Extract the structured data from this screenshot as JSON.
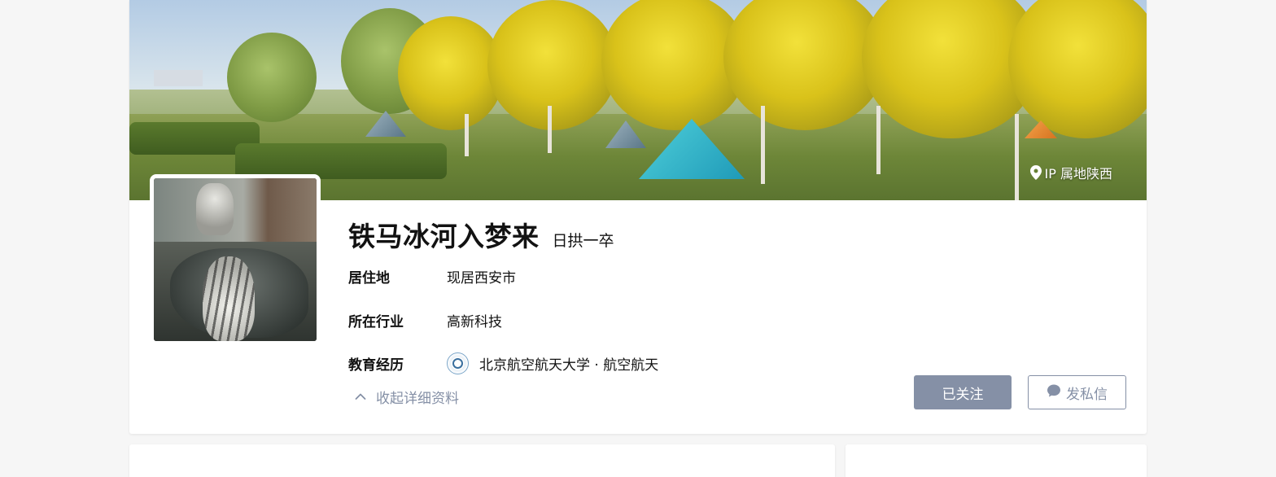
{
  "profile": {
    "name": "铁马冰河入梦来",
    "headline": "日拱一卒",
    "ip_location": "IP 属地陕西"
  },
  "details": {
    "residence": {
      "label": "居住地",
      "value": "现居西安市"
    },
    "industry": {
      "label": "所在行业",
      "value": "高新科技"
    },
    "education": {
      "label": "教育经历",
      "value": "北京航空航天大学 · 航空航天"
    }
  },
  "actions": {
    "collapse_label": "收起详细资料",
    "followed_label": "已关注",
    "message_label": "发私信"
  },
  "colors": {
    "accent_grey": "#8590a6",
    "text": "#121212",
    "page_bg": "#f6f6f6"
  },
  "icons": {
    "location": "map-pin-icon",
    "collapse": "chevron-up-icon",
    "message": "chat-bubble-icon",
    "school": "school-logo-icon"
  }
}
